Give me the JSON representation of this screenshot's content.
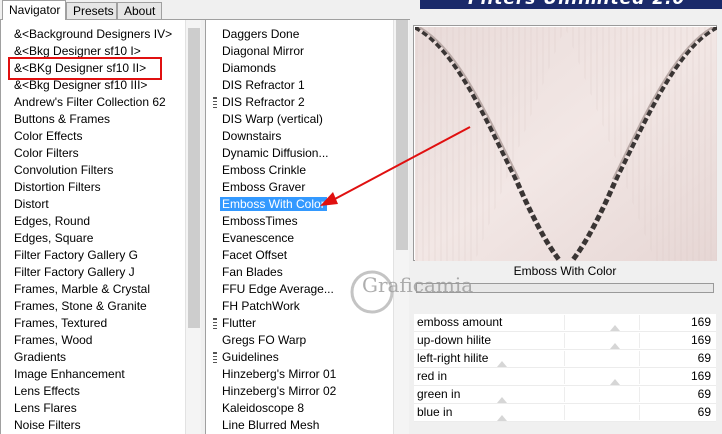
{
  "tabs": [
    "Navigator",
    "Presets",
    "About"
  ],
  "banner_title": "Filters Unlimited 2.0",
  "categories": [
    "&<Background Designers IV>",
    "&<Bkg Designer sf10 I>",
    "&<BKg Designer sf10 II>",
    "&<Bkg Designer sf10 III>",
    "Andrew's Filter Collection 62",
    "Buttons & Frames",
    "Color Effects",
    "Color Filters",
    "Convolution Filters",
    "Distortion Filters",
    "Distort",
    "Edges, Round",
    "Edges, Square",
    "Filter Factory Gallery G",
    "Filter Factory Gallery J",
    "Frames, Marble & Crystal",
    "Frames, Stone & Granite",
    "Frames, Textured",
    "Frames, Wood",
    "Gradients",
    "Image Enhancement",
    "Lens Effects",
    "Lens Flares",
    "Noise Filters"
  ],
  "filters": [
    "Daggers Done",
    "Diagonal Mirror",
    "Diamonds",
    "DIS Refractor 1",
    "DIS Refractor 2",
    "DIS Warp (vertical)",
    "Downstairs",
    "Dynamic Diffusion...",
    "Emboss Crinkle",
    "Emboss Graver",
    "Emboss With Color",
    "EmbossTimes",
    "Evanescence",
    "Facet Offset",
    "Fan Blades",
    "FFU Edge Average...",
    "FH PatchWork",
    "Flutter",
    "Gregs FO Warp",
    "Guidelines",
    "Hinzeberg's Mirror 01",
    "Hinzeberg's Mirror 02",
    "Kaleidoscope 8",
    "Line Blurred Mesh"
  ],
  "filter_grips": [
    4,
    17,
    19
  ],
  "highlighted_category": 2,
  "selected_filter": 10,
  "selected_filter_name": "Emboss With Color",
  "watermark_text": "Graficamia",
  "parameters": [
    {
      "name": "emboss amount",
      "value": "169",
      "level": 0.66
    },
    {
      "name": "up-down hilite",
      "value": "169",
      "level": 0.66
    },
    {
      "name": "left-right hilite",
      "value": "69",
      "level": 0.27
    },
    {
      "name": "red in",
      "value": "169",
      "level": 0.66
    },
    {
      "name": "green in",
      "value": "69",
      "level": 0.27
    },
    {
      "name": "blue in",
      "value": "69",
      "level": 0.27
    }
  ],
  "colors": {
    "selection": "#3399ff",
    "highlight_box": "#e01010",
    "arrow": "#e01010",
    "banner": "#1a2a6a",
    "preview_bg": "#efe2e0"
  }
}
